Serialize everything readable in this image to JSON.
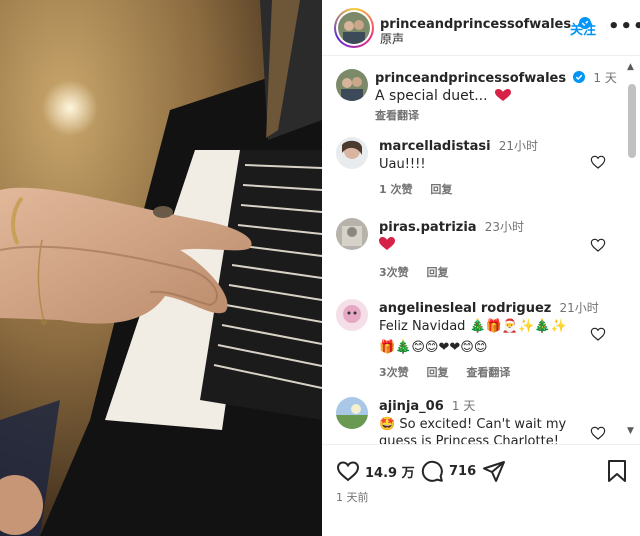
{
  "post": {
    "username": "princeandprincessofwales",
    "audio": "原声",
    "follow_label": "关注",
    "more_label": "•••",
    "caption": "A special duet...",
    "caption_time": "1 天",
    "see_translation": "查看翻译",
    "likes": "14.9 万",
    "comments_count": "716",
    "posted_ago": "1 天前"
  },
  "comments": [
    {
      "username": "marcelladistasi",
      "time": "21小时",
      "text": "Uau!!!!",
      "likes_label": "1 次赞",
      "reply_label": "回复"
    },
    {
      "username": "piras.patrizia",
      "time": "23小时",
      "text": "",
      "likes_label": "3次赞",
      "reply_label": "回复"
    },
    {
      "username": "angelinesleal rodriguez",
      "username_display": "angelinesleal rodriguez",
      "time": "21小时",
      "text": "Feliz Navidad",
      "likes_label": "3次赞",
      "reply_label": "回复",
      "translate_label": "查看翻译"
    },
    {
      "username": "ajinja_06",
      "time": "1 天",
      "text": "So excited! Can't wait my guess is Princess Charlotte!"
    }
  ],
  "colors": {
    "link_blue": "#0095f6",
    "heart_red": "#ed4956",
    "verified_blue": "#0095f6"
  },
  "icons": [
    "heart-icon",
    "comment-icon",
    "share-icon",
    "bookmark-icon",
    "verified-icon",
    "more-icon"
  ]
}
